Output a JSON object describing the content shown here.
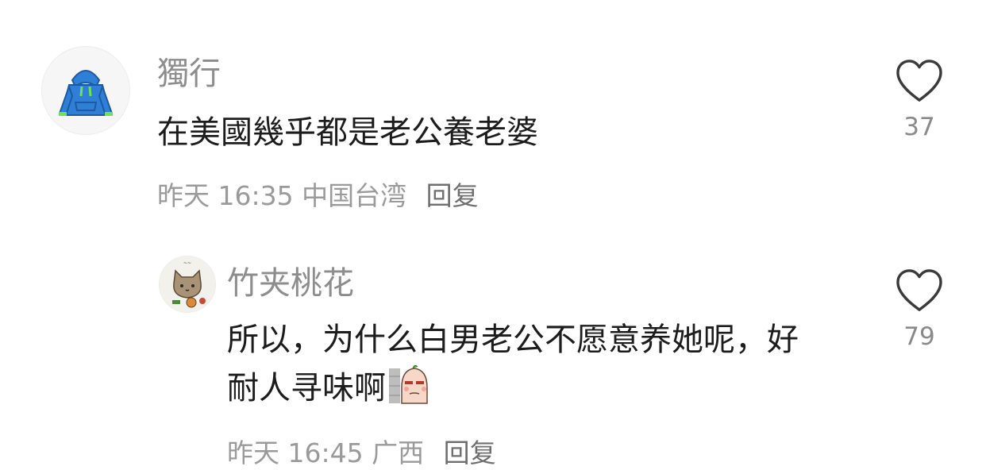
{
  "comments": [
    {
      "username": "獨行",
      "text": "在美國幾乎都是老公養老婆",
      "time": "昨天 16:35",
      "location": "中国台湾",
      "reply_label": "回复",
      "likes": "37",
      "avatar_icon": "blue-hoodie-icon"
    },
    {
      "username": "竹夹桃花",
      "text": "所以，为什么白男老公不愿意养她呢，好耐人寻味啊",
      "time": "昨天 16:45",
      "location": "广西",
      "reply_label": "回复",
      "likes": "79",
      "avatar_icon": "cat-avatar-icon",
      "sticker_icon": "smirk-sticker-icon"
    }
  ],
  "colors": {
    "text": "#1c1c1c",
    "username": "#8d8d8d",
    "meta": "#9a9a9a",
    "reply": "#6f6f6f",
    "heart": "#3a3a3a",
    "hoodie": "#2f7fd6"
  }
}
